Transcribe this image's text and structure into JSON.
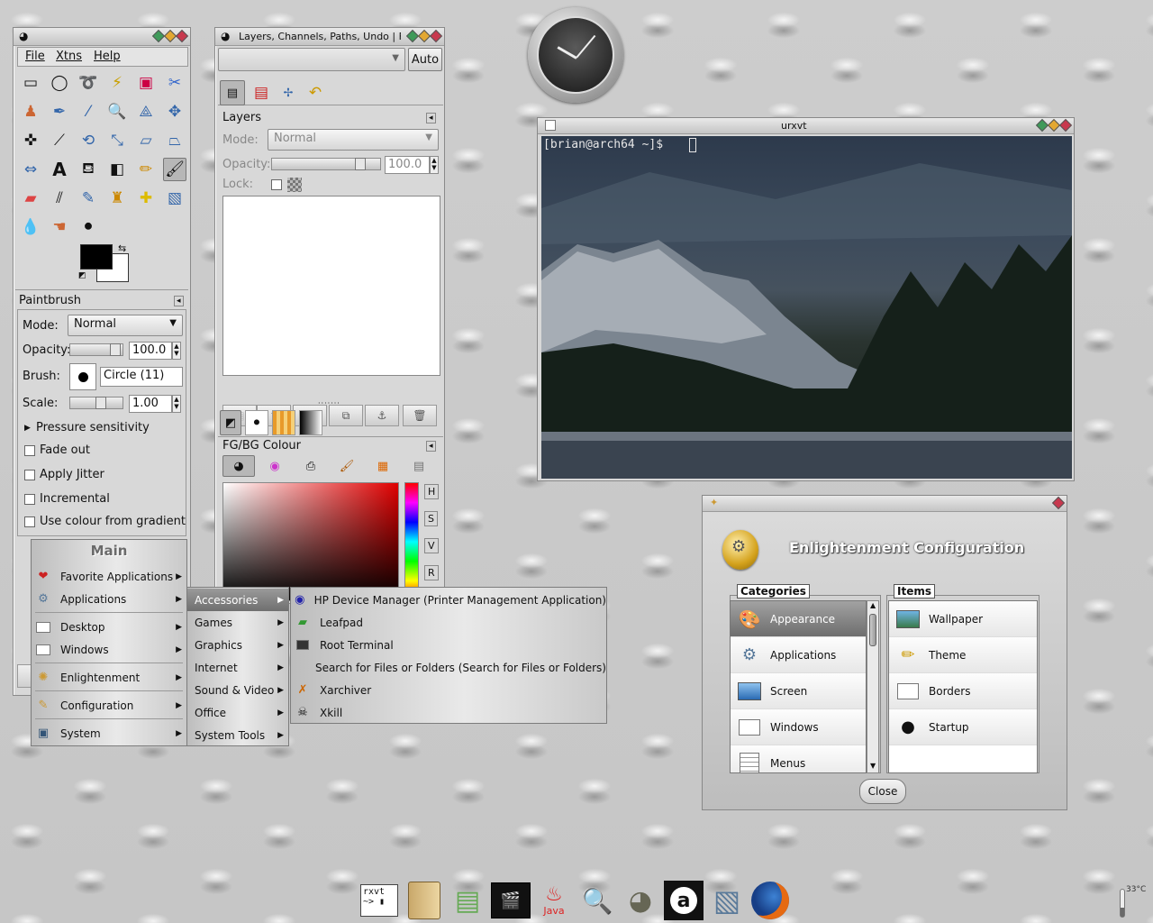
{
  "toolbox": {
    "menu": [
      "File",
      "Xtns",
      "Help"
    ],
    "panel_title": "Paintbrush",
    "mode_label": "Mode:",
    "mode_value": "Normal",
    "opacity_label": "Opacity:",
    "opacity_value": "100.0",
    "brush_label": "Brush:",
    "brush_value": "Circle (11)",
    "scale_label": "Scale:",
    "scale_value": "1.00",
    "pressure_label": "Pressure sensitivity",
    "options": [
      "Fade out",
      "Apply Jitter",
      "Incremental",
      "Use colour from gradient"
    ]
  },
  "layers_window": {
    "title": "Layers, Channels, Paths, Undo | F...",
    "auto_button": "Auto",
    "layers_title": "Layers",
    "mode_label": "Mode:",
    "mode_value": "Normal",
    "opacity_label": "Opacity:",
    "opacity_value": "100.0",
    "lock_label": "Lock:",
    "fgbg_title": "FG/BG Colour",
    "hsv_letters": [
      "H",
      "S",
      "V",
      "R"
    ]
  },
  "terminal": {
    "title": "urxvt",
    "prompt": "[brian@arch64 ~]$"
  },
  "main_menu": {
    "title": "Main",
    "items": [
      {
        "label": "Favorite Applications",
        "icon": "heart-icon"
      },
      {
        "label": "Applications",
        "icon": "applications-icon"
      },
      {
        "label": "Desktop",
        "icon": "desktop-icon"
      },
      {
        "label": "Windows",
        "icon": "windows-icon"
      },
      {
        "label": "Enlightenment",
        "icon": "enlightenment-icon"
      },
      {
        "label": "Configuration",
        "icon": "configuration-icon"
      },
      {
        "label": "System",
        "icon": "system-icon"
      }
    ]
  },
  "applications_menu": [
    "Accessories",
    "Games",
    "Graphics",
    "Internet",
    "Sound & Video",
    "Office",
    "System Tools"
  ],
  "accessories_menu": [
    {
      "label": "HP Device Manager (Printer Management Application)",
      "icon": "hp-icon"
    },
    {
      "label": "Leafpad",
      "icon": "leafpad-icon"
    },
    {
      "label": "Root Terminal",
      "icon": "terminal-icon"
    },
    {
      "label": "Search for Files or Folders (Search for Files or Folders)",
      "icon": "search-icon"
    },
    {
      "label": "Xarchiver",
      "icon": "xarchiver-icon"
    },
    {
      "label": "Xkill",
      "icon": "xkill-icon"
    }
  ],
  "e_config": {
    "title": "Enlightenment Configuration",
    "categories_label": "Categories",
    "items_label": "Items",
    "categories": [
      "Appearance",
      "Applications",
      "Screen",
      "Windows",
      "Menus"
    ],
    "items": [
      "Wallpaper",
      "Theme",
      "Borders",
      "Startup"
    ],
    "close_button": "Close"
  },
  "temperature": "33°C",
  "dock": {
    "java_label": "Java",
    "rxvt_label": "rxvt"
  },
  "colors": {
    "accent_red": "#c8384e",
    "accent_green": "#3f9a5a",
    "accent_yellow": "#e3a832"
  }
}
